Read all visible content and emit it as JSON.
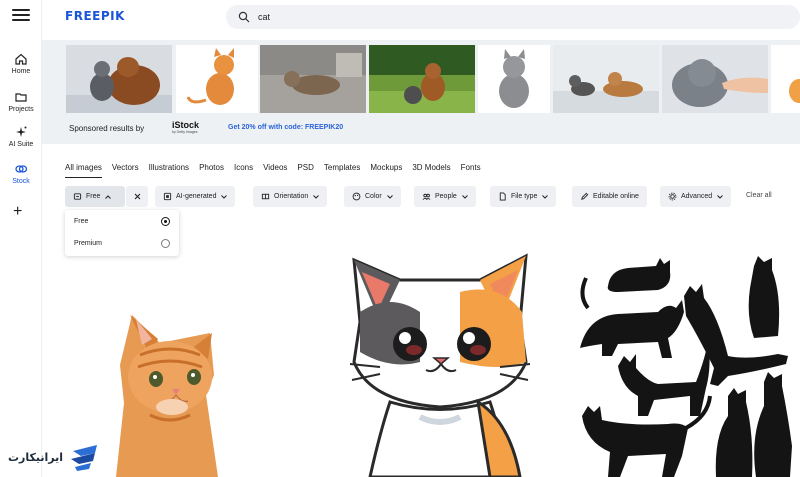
{
  "header": {
    "logo_text": "FREEPIK",
    "search": {
      "value": "cat"
    }
  },
  "sidebar": {
    "items": [
      {
        "label": "Home",
        "icon": "home-icon"
      },
      {
        "label": "Projects",
        "icon": "folder-icon"
      },
      {
        "label": "AI Suite",
        "icon": "sparkle-icon"
      },
      {
        "label": "Stock",
        "icon": "stock-icon",
        "active": true
      }
    ]
  },
  "sponsored": {
    "label": "Sponsored results by",
    "provider": "iStock",
    "provider_sub": "by Getty Images",
    "promo": "Get 20% off with code: FREEPIK20"
  },
  "tabs": [
    "All images",
    "Vectors",
    "Illustrations",
    "Photos",
    "Icons",
    "Videos",
    "PSD",
    "Templates",
    "Mockups",
    "3D Models",
    "Fonts"
  ],
  "filters": {
    "free": "Free",
    "ai_generated": "AI-generated",
    "orientation": "Orientation",
    "color": "Color",
    "people": "People",
    "file_type": "File type",
    "editable": "Editable online",
    "advanced": "Advanced",
    "clear_all": "Clear all"
  },
  "license_dropdown": {
    "options": [
      {
        "label": "Free",
        "selected": true
      },
      {
        "label": "Premium",
        "selected": false
      }
    ]
  },
  "watermark": {
    "text": "ایرانیکارت"
  },
  "colors": {
    "accent": "#1a55d8",
    "promo": "#2a63d9",
    "panel": "#eef1f4"
  }
}
